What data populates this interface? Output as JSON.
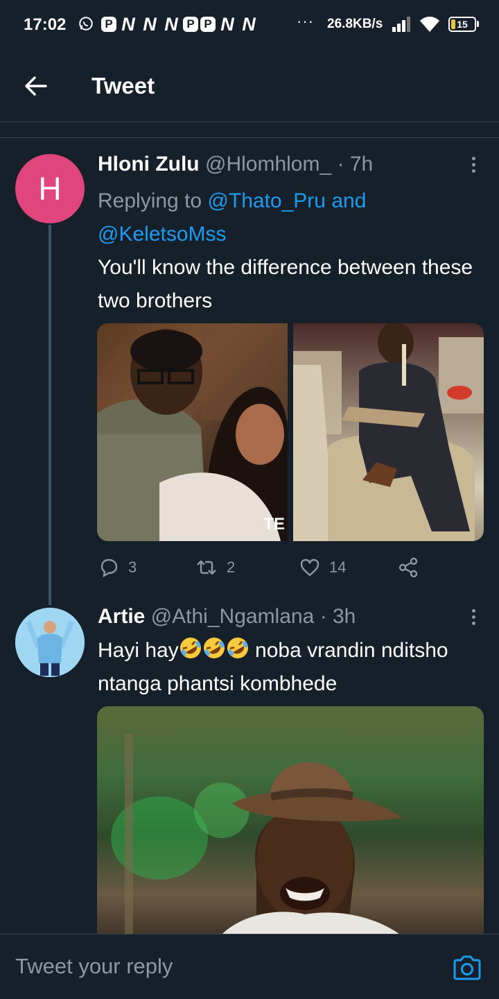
{
  "status_bar": {
    "time": "17:02",
    "notification_icons": [
      "P",
      "N",
      "N",
      "N",
      "P",
      "P",
      "N",
      "N"
    ],
    "overflow": "···",
    "net_speed": "26.8KB/s",
    "battery": "15"
  },
  "header": {
    "title": "Tweet"
  },
  "tweet1": {
    "avatar_letter": "H",
    "avatar_color": "#e0457b",
    "name": "Hloni Zulu",
    "handle": "@Hlomhlom_",
    "time": "· 7h",
    "replying_prefix": "Replying to",
    "replying_user1": "@Thato_Pru",
    "replying_and": "and",
    "replying_user2": "@KeletsoMss",
    "text": "You'll know the difference between these two brothers",
    "watermark": "TE",
    "replies": "3",
    "retweets": "2",
    "likes": "14"
  },
  "tweet2": {
    "name": "Artie",
    "handle": "@Athi_Ngamlana",
    "time": "· 3h",
    "text_before": "Hayi hay",
    "text_after": " noba vrandin nditsho ntanga phantsi kombhede"
  },
  "reply_bar": {
    "placeholder": "Tweet your reply"
  },
  "colors": {
    "background": "#15202b",
    "link": "#1d9bf0",
    "secondary_text": "#8b98a5",
    "divider": "#38444d"
  }
}
